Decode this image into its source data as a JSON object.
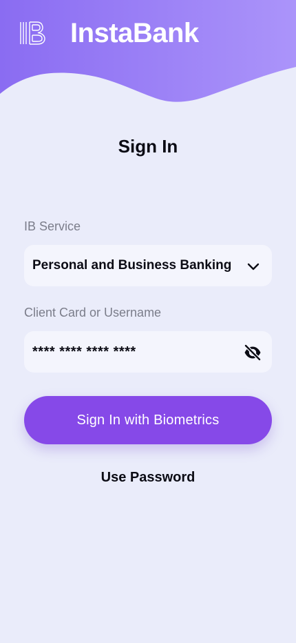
{
  "header": {
    "brand_name": "InstaBank",
    "logo_icon": "ib-logo-icon",
    "gradient_start": "#8a6cf2",
    "gradient_end": "#ab94fa"
  },
  "page": {
    "title": "Sign In",
    "background": "#eaecfa"
  },
  "form": {
    "service_label": "IB Service",
    "service_value": "Personal and Business Banking",
    "service_icon": "chevron-down-icon",
    "client_label": "Client Card or Username",
    "client_value": "**** **** **** ****",
    "visibility_icon": "eye-off-icon"
  },
  "actions": {
    "biometrics_label": "Sign In with Biometrics",
    "biometrics_color": "#8649e8",
    "password_label": "Use Password"
  }
}
